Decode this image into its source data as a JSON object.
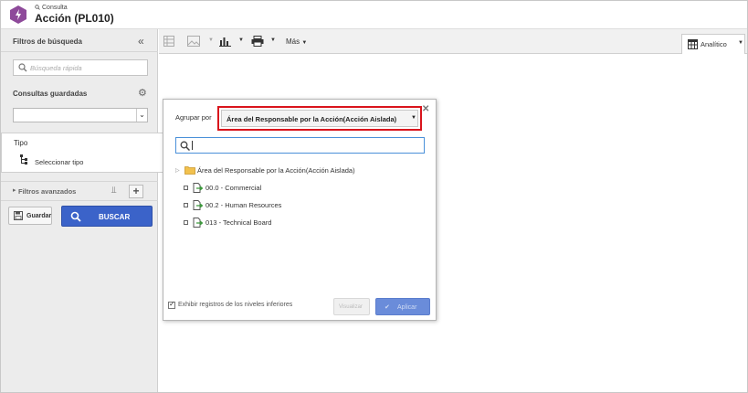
{
  "header": {
    "subtitle": "Consulta",
    "title": "Acción (PL010)"
  },
  "left_panel": {
    "filters_title": "Filtros de búsqueda",
    "search_placeholder": "Búsqueda rápida",
    "saved_queries_title": "Consultas guardadas",
    "saved_queries_value": "",
    "tipo_title": "Tipo",
    "tipo_select_label": "Seleccionar tipo",
    "advanced_filters_label": "Filtros avanzados",
    "save_label": "Guardar",
    "search_label": "BUSCAR"
  },
  "toolbar": {
    "more_label": "Más",
    "view_label": "Analítico"
  },
  "dialog": {
    "group_by_label": "Agrupar por",
    "group_by_value": "Área del Responsable por la Acción(Acción Aislada)",
    "search_value": "",
    "tree": {
      "root_label": "Área del Responsable por la Acción(Acción Aislada)",
      "items": [
        {
          "label": "00.0 - Commercial"
        },
        {
          "label": "00.2 - Human Resources"
        },
        {
          "label": "013 - Technical Board"
        }
      ]
    },
    "include_lower_levels_label": "Exhibir registros de los niveles inferiores",
    "include_lower_levels_checked": true,
    "visualize_label": "Visualizar",
    "apply_label": "Aplicar"
  },
  "colors": {
    "accent": "#3b63c9",
    "highlight_border": "#d9141c",
    "app_icon": "#8e4a9a"
  }
}
